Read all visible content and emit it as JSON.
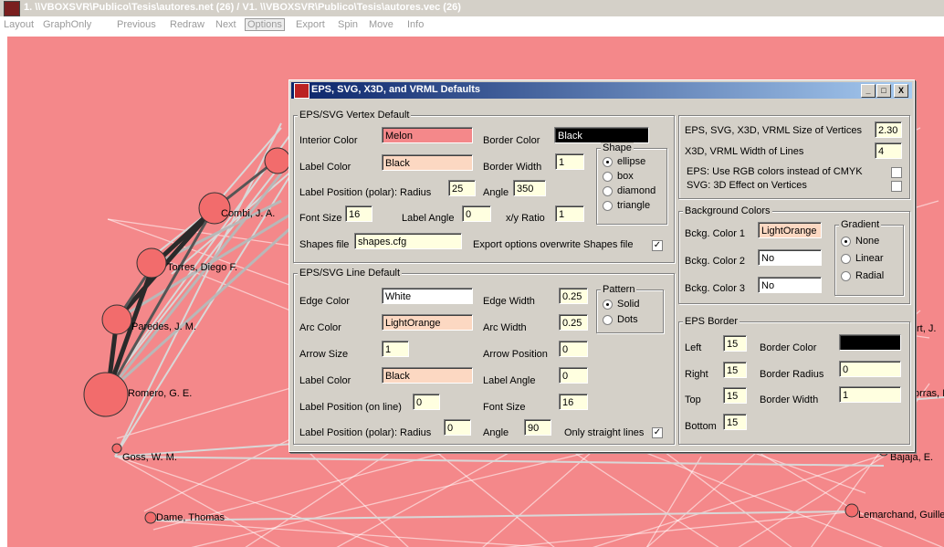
{
  "window": {
    "title": "1. \\\\VBOXSVR\\Publico\\Tesis\\autores.net (26) / V1. \\\\VBOXSVR\\Publico\\Tesis\\autores.vec (26)"
  },
  "menu": [
    "Layout",
    "GraphOnly",
    "Previous",
    "Redraw",
    "Next",
    "Options",
    "Export",
    "Spin",
    "Move",
    "Info"
  ],
  "menu_active": "Options",
  "graph_labels": [
    "Combi, J. A.",
    "Torres, Diego F.",
    "Paredes, J. M.",
    "Romero, G. E.",
    "Goss, W. M.",
    "Dame, Thomas",
    "Bajaja, E.",
    "Lemarchand, Guille",
    "orras, I",
    "rt, J."
  ],
  "dialog": {
    "title": "EPS, SVG, X3D, and VRML Defaults",
    "buttons": {
      "min": "_",
      "max": "□",
      "close": "X"
    },
    "vertex": {
      "title": "EPS/SVG Vertex Default",
      "interior_color_label": "Interior Color",
      "interior_color": "Melon",
      "border_color_label": "Border Color",
      "border_color": "Black",
      "label_color_label": "Label Color",
      "label_color": "Black",
      "border_width_label": "Border Width",
      "border_width": "1",
      "label_pos_label": "Label Position (polar): Radius",
      "label_pos_radius": "25",
      "angle_label": "Angle",
      "angle": "350",
      "font_size_label": "Font Size",
      "font_size": "16",
      "label_angle_label": "Label Angle",
      "label_angle": "0",
      "xy_ratio_label": "x/y Ratio",
      "xy_ratio": "1",
      "shapes_file_label": "Shapes file",
      "shapes_file": "shapes.cfg",
      "export_overwrite_label": "Export options overwrite Shapes file",
      "shape_title": "Shape",
      "shapes": [
        "ellipse",
        "box",
        "diamond",
        "triangle"
      ],
      "shape_selected": "ellipse"
    },
    "line": {
      "title": "EPS/SVG Line Default",
      "edge_color_label": "Edge Color",
      "edge_color": "White",
      "edge_width_label": "Edge Width",
      "edge_width": "0.25",
      "arc_color_label": "Arc Color",
      "arc_color": "LightOrange",
      "arc_width_label": "Arc Width",
      "arc_width": "0.25",
      "arrow_size_label": "Arrow Size",
      "arrow_size": "1",
      "arrow_position_label": "Arrow Position",
      "arrow_position": "0",
      "label_color_label": "Label Color",
      "label_color": "Black",
      "label_angle_label": "Label Angle",
      "label_angle": "0",
      "label_pos_line_label": "Label Position (on line)",
      "label_pos_line": "0",
      "font_size_label": "Font Size",
      "font_size": "16",
      "label_pos_polar_label": "Label Position (polar): Radius",
      "label_pos_polar": "0",
      "angle_label": "Angle",
      "angle": "90",
      "straight_label": "Only straight lines",
      "pattern_title": "Pattern",
      "patterns": [
        "Solid",
        "Dots"
      ],
      "pattern_selected": "Solid"
    },
    "sizes": {
      "vertex_size_label": "EPS, SVG, X3D, VRML Size of Vertices",
      "vertex_size": "2.30",
      "line_width_label": "X3D, VRML Width of Lines",
      "line_width": "4",
      "rgb_label": "EPS: Use RGB colors instead of CMYK",
      "effect3d_label": "SVG: 3D Effect on Vertices"
    },
    "background": {
      "title": "Background Colors",
      "color1_label": "Bckg. Color 1",
      "color1": "LightOrange",
      "color2_label": "Bckg. Color 2",
      "color2": "No",
      "color3_label": "Bckg. Color 3",
      "color3": "No",
      "gradient_title": "Gradient",
      "gradients": [
        "None",
        "Linear",
        "Radial"
      ],
      "gradient_selected": "None"
    },
    "border": {
      "title": "EPS Border",
      "left_label": "Left",
      "left": "15",
      "right_label": "Right",
      "right": "15",
      "top_label": "Top",
      "top": "15",
      "bottom_label": "Bottom",
      "bottom": "15",
      "border_color_label": "Border Color",
      "border_radius_label": "Border Radius",
      "border_radius": "0",
      "border_width_label": "Border Width",
      "border_width": "1"
    }
  },
  "colors": {
    "canvas": "#f4888a",
    "node": "#f26c6c",
    "edge": "#ffffff",
    "title_active": "#0a246a",
    "peach": "#fcd8c2"
  }
}
